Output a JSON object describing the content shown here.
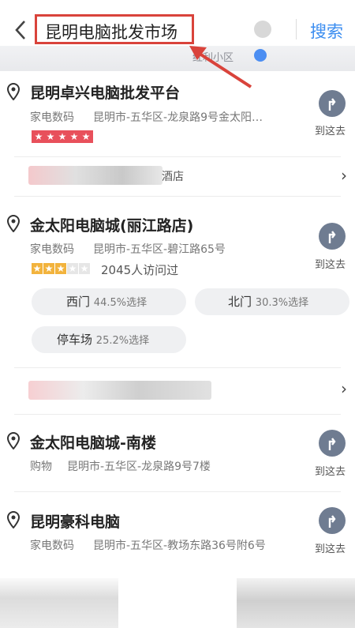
{
  "header": {
    "search_value": "昆明电脑批发市场",
    "search_button": "搜索"
  },
  "map": {
    "label": "红利小区"
  },
  "results": [
    {
      "title": "昆明卓兴电脑批发平台",
      "category": "家电数码",
      "address": "昆明市-五华区-龙泉路9号金太阳…",
      "rating": 5,
      "goto_label": "到这去",
      "extra_row_text": "酒店"
    },
    {
      "title": "金太阳电脑城(丽江路店)",
      "category": "家电数码",
      "address": "昆明市-五华区-碧江路65号",
      "rating": 3,
      "visits": "2045人访问过",
      "goto_label": "到这去",
      "entrances": [
        {
          "name": "西门",
          "pct": "44.5%选择"
        },
        {
          "name": "北门",
          "pct": "30.3%选择"
        },
        {
          "name": "停车场",
          "pct": "25.2%选择"
        }
      ]
    },
    {
      "title": "金太阳电脑城-南楼",
      "category": "购物",
      "address": "昆明市-五华区-龙泉路9号7楼",
      "goto_label": "到这去"
    },
    {
      "title": "昆明豪科电脑",
      "category": "家电数码",
      "address": "昆明市-五华区-教场东路36号附6号",
      "goto_label": "到这去"
    }
  ],
  "colors": {
    "accent_blue": "#3b8df0",
    "highlight_red": "#d9433b",
    "star_red": "#e8505b",
    "star_gold": "#f2b33d",
    "nav_gray": "#6f7c91"
  }
}
